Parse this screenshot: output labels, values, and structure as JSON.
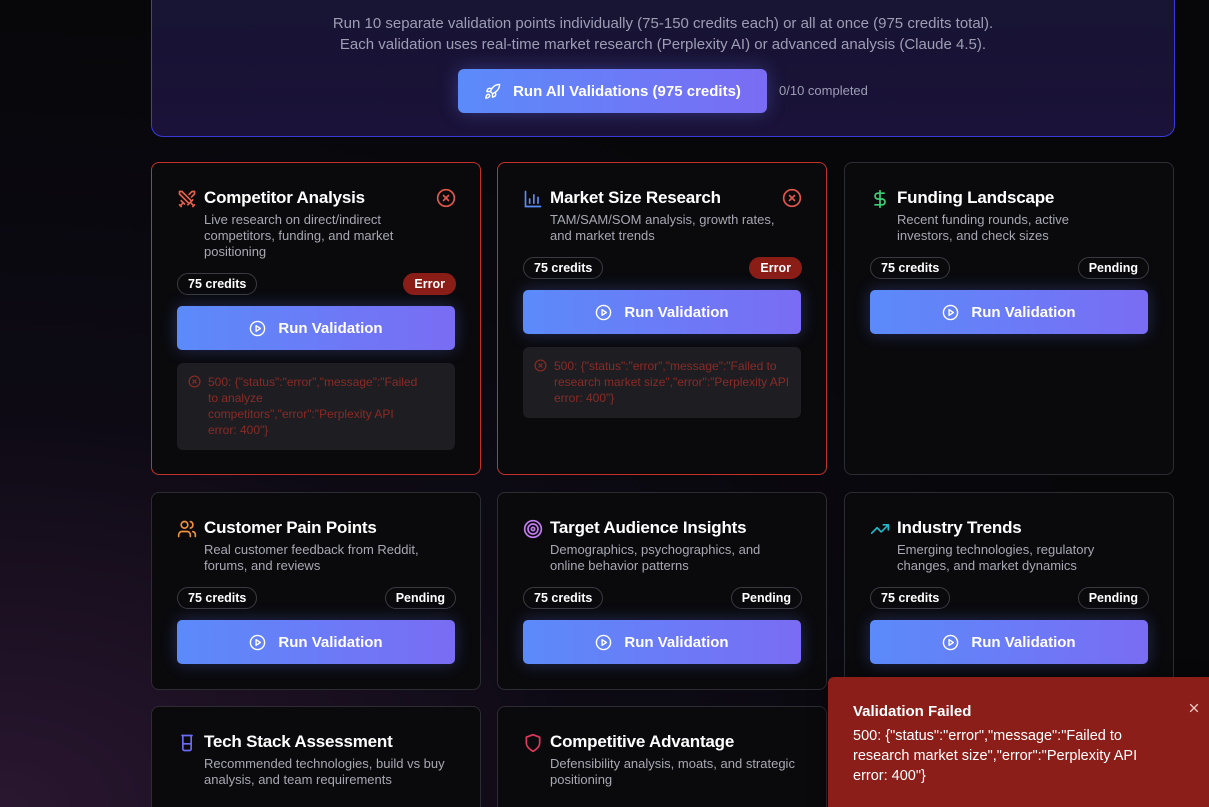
{
  "hero": {
    "description_line1": "Run 10 separate validation points individually (75-150 credits each) or all at once (975 credits total).",
    "description_line2": "Each validation uses real-time market research (Perplexity AI) or advanced analysis (Claude 4.5).",
    "run_all_label": "Run All Validations (975 credits)",
    "progress": "0/10 completed"
  },
  "colors": {
    "accent_gradient_start": "#5b8bfa",
    "accent_gradient_end": "#7a6cf4",
    "error_red": "#c2322a",
    "error_badge": "#8b1d17"
  },
  "run_label": "Run Validation",
  "cards": [
    {
      "title": "Competitor Analysis",
      "description": "Live research on direct/indirect competitors, funding, and market positioning",
      "credits": "75 credits",
      "status": "Error",
      "icon": "swords-icon",
      "error": "500: {\"status\":\"error\",\"message\":\"Failed to analyze competitors\",\"error\":\"Perplexity API error: 400\"}"
    },
    {
      "title": "Market Size Research",
      "description": "TAM/SAM/SOM analysis, growth rates, and market trends",
      "credits": "75 credits",
      "status": "Error",
      "icon": "bar-chart-icon",
      "error": "500: {\"status\":\"error\",\"message\":\"Failed to research market size\",\"error\":\"Perplexity API error: 400\"}"
    },
    {
      "title": "Funding Landscape",
      "description": "Recent funding rounds, active investors, and check sizes",
      "credits": "75 credits",
      "status": "Pending",
      "icon": "dollar-icon"
    },
    {
      "title": "Customer Pain Points",
      "description": "Real customer feedback from Reddit, forums, and reviews",
      "credits": "75 credits",
      "status": "Pending",
      "icon": "users-icon"
    },
    {
      "title": "Target Audience Insights",
      "description": "Demographics, psychographics, and online behavior patterns",
      "credits": "75 credits",
      "status": "Pending",
      "icon": "target-icon"
    },
    {
      "title": "Industry Trends",
      "description": "Emerging technologies, regulatory changes, and market dynamics",
      "credits": "75 credits",
      "status": "Pending",
      "icon": "trending-up-icon"
    },
    {
      "title": "Tech Stack Assessment",
      "description": "Recommended technologies, build vs buy analysis, and team requirements",
      "icon": "cylinder-icon"
    },
    {
      "title": "Competitive Advantage",
      "description": "Defensibility analysis, moats, and strategic positioning",
      "icon": "shield-icon"
    }
  ],
  "toast": {
    "title": "Validation Failed",
    "message": "500: {\"status\":\"error\",\"message\":\"Failed to research market size\",\"error\":\"Perplexity API error: 400\"}"
  }
}
